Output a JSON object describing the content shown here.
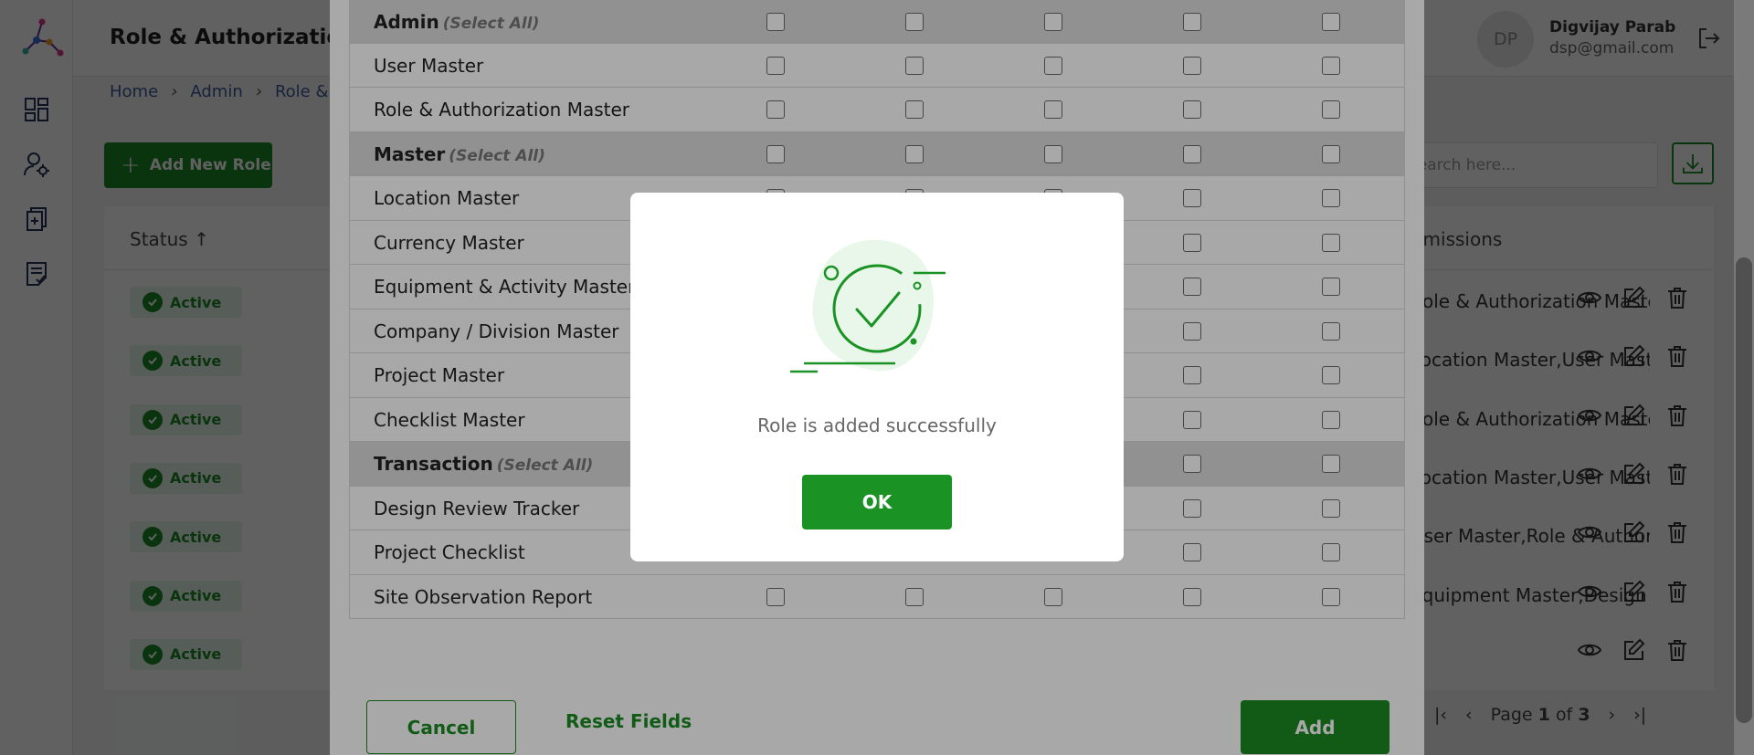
{
  "header": {
    "title": "Role & Authorization Master",
    "user_initials": "DP",
    "user_name": "Digvijay Parab",
    "user_email": "dsp@gmail.com"
  },
  "breadcrumb": [
    "Home",
    "Admin",
    "Role & Authorization Master"
  ],
  "toolbar": {
    "add_role_label": "Add New Role",
    "search_placeholder": "Search here..."
  },
  "table": {
    "status_header": "Status",
    "permissions_header": "Permissions",
    "rows": [
      {
        "status": "Active",
        "permissions": "Role & Authorization Master,User Master"
      },
      {
        "status": "Active",
        "permissions": "Location Master,User Master,"
      },
      {
        "status": "Active",
        "permissions": "Role & Authorization Master"
      },
      {
        "status": "Active",
        "permissions": "Location Master,User Master,"
      },
      {
        "status": "Active",
        "permissions": "User Master,Role & Authorization"
      },
      {
        "status": "Active",
        "permissions": "Equipment Master,Design Review"
      },
      {
        "status": "Active",
        "permissions": ""
      }
    ]
  },
  "pagination": {
    "label_page": "Page",
    "current": "1",
    "label_of": "of",
    "total": "3"
  },
  "form": {
    "select_all_label": "(Select All)",
    "rows": [
      {
        "label": "Admin",
        "group": true
      },
      {
        "label": "User Master",
        "group": false
      },
      {
        "label": "Role & Authorization Master",
        "group": false
      },
      {
        "label": "Master",
        "group": true
      },
      {
        "label": "Location Master",
        "group": false
      },
      {
        "label": "Currency Master",
        "group": false
      },
      {
        "label": "Equipment & Activity Master",
        "group": false
      },
      {
        "label": "Company / Division Master",
        "group": false
      },
      {
        "label": "Project Master",
        "group": false
      },
      {
        "label": "Checklist Master",
        "group": false
      },
      {
        "label": "Transaction",
        "group": true
      },
      {
        "label": "Design Review Tracker",
        "group": false
      },
      {
        "label": "Project Checklist",
        "group": false
      },
      {
        "label": "Site Observation Report",
        "group": false
      }
    ],
    "cancel_label": "Cancel",
    "reset_label": "Reset Fields",
    "add_label": "Add"
  },
  "dialog": {
    "message": "Role is added successfully",
    "ok_label": "OK"
  },
  "colors": {
    "primary_green": "#1b8a24",
    "success_light": "#e6f4e7"
  }
}
